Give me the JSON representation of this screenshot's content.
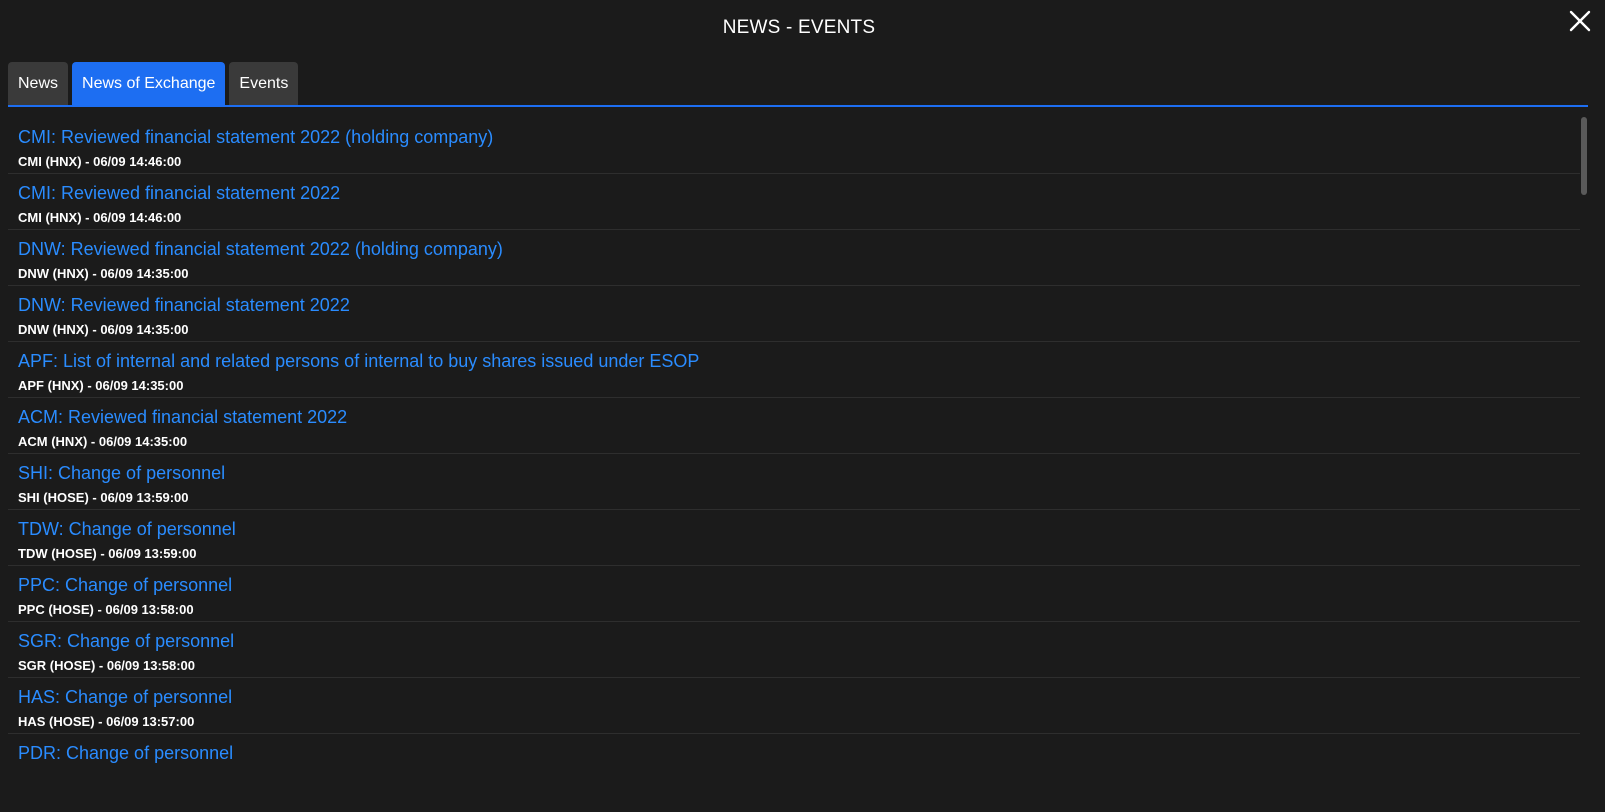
{
  "dialog": {
    "title": "NEWS - EVENTS",
    "close_icon": "close-icon"
  },
  "tabs": [
    {
      "label": "News",
      "active": false
    },
    {
      "label": "News of Exchange",
      "active": true
    },
    {
      "label": "Events",
      "active": false
    }
  ],
  "colors": {
    "background": "#1b1b1b",
    "accent": "#1d6ef2",
    "link": "#2a8cff",
    "tab_inactive": "#3a3a3a"
  },
  "news": [
    {
      "title": "CMI: Reviewed financial statement 2022 (holding company)",
      "meta": "CMI (HNX) - 06/09 14:46:00"
    },
    {
      "title": "CMI: Reviewed financial statement 2022",
      "meta": "CMI (HNX) - 06/09 14:46:00"
    },
    {
      "title": "DNW: Reviewed financial statement 2022 (holding company)",
      "meta": "DNW (HNX) - 06/09 14:35:00"
    },
    {
      "title": "DNW: Reviewed financial statement 2022",
      "meta": "DNW (HNX) - 06/09 14:35:00"
    },
    {
      "title": "APF: List of internal and related persons of internal to buy shares issued under ESOP",
      "meta": "APF (HNX) - 06/09 14:35:00"
    },
    {
      "title": "ACM: Reviewed financial statement 2022",
      "meta": "ACM (HNX) - 06/09 14:35:00"
    },
    {
      "title": "SHI: Change of personnel",
      "meta": "SHI (HOSE) - 06/09 13:59:00"
    },
    {
      "title": "TDW: Change of personnel",
      "meta": "TDW (HOSE) - 06/09 13:59:00"
    },
    {
      "title": "PPC: Change of personnel",
      "meta": "PPC (HOSE) - 06/09 13:58:00"
    },
    {
      "title": "SGR: Change of personnel",
      "meta": "SGR (HOSE) - 06/09 13:58:00"
    },
    {
      "title": "HAS: Change of personnel",
      "meta": "HAS (HOSE) - 06/09 13:57:00"
    },
    {
      "title": "PDR: Change of personnel",
      "meta": ""
    }
  ]
}
